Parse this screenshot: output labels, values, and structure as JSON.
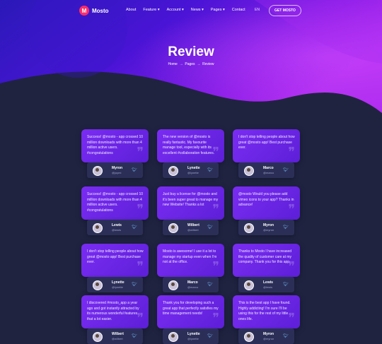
{
  "brand": {
    "name": "Mosto",
    "logo_glyph": "M",
    "accent": "#ff2d6a"
  },
  "nav": {
    "items": [
      "About",
      "Feature ▾",
      "Account ▾",
      "News ▾",
      "Pages ▾",
      "Contact"
    ],
    "lang": "EN",
    "cta": "GET MOSTO"
  },
  "hero": {
    "title": "Review",
    "breadcrumb": [
      "Home",
      "Pages",
      "Review"
    ]
  },
  "reviews": [
    {
      "text": "Success! @mosto - app crossed 10 million downloads with more than 4 million active users. #congratulations",
      "name": "Myron",
      "handle": "@joymi"
    },
    {
      "text": "The new version of @mosto is really fantastic. My favourite manage tool, especially with its excellent #collaboration features.",
      "name": "Lynette",
      "handle": "@lynette"
    },
    {
      "text": "I don't stop telling people about how great @mosto app! Best purchase ever.",
      "name": "Marco",
      "handle": "@marco"
    },
    {
      "text": "Success! @mosto - app crossed 10 million downloads with more than 4 million active users. #congratulations",
      "name": "Lewis",
      "handle": "@lewis"
    },
    {
      "text": "Just buy a license for @mosto and it's been super great to manage my new Website! Thanks a lot",
      "name": "Wilbert",
      "handle": "@wilbert"
    },
    {
      "text": "@mosto Would you please add vimeo icons to your app? Thanks in advance!",
      "name": "Myron",
      "handle": "@myron"
    },
    {
      "text": "I don't stop telling people about how great @mosto app! Best purchase ever.",
      "name": "Lynette",
      "handle": "@lynette"
    },
    {
      "text": "Mosto is awesome! I use it a lot to manage my startup even when I'm not at the office.",
      "name": "Marco",
      "handle": "@marco"
    },
    {
      "text": "Thanks to Mosto I have increased the quality of customer care at my company. Thank you for this app",
      "name": "Lewis",
      "handle": "@lewis"
    },
    {
      "text": "I discovered #mosto_app a year ago and got instantly attracted by its numerous wonderful features that a lot easier.",
      "name": "Wilbert",
      "handle": "@wilbert"
    },
    {
      "text": "Thank you for developing such a great app that perfectly satisfies my time management needs!",
      "name": "Lynette",
      "handle": "@lynette"
    },
    {
      "text": "This is the best app I have found. Highly addicting! I'm sure I'll be using this for the rest of my little ones life.",
      "name": "Myron",
      "handle": "@myron"
    }
  ]
}
